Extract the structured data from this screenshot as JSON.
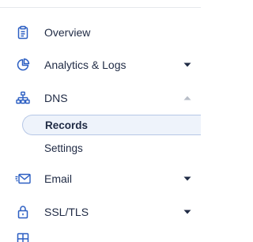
{
  "nav": {
    "items": [
      {
        "key": "overview",
        "label": "Overview",
        "icon": "clipboard-icon",
        "chevron": null
      },
      {
        "key": "analytics",
        "label": "Analytics & Logs",
        "icon": "pie-chart-icon",
        "chevron": "down"
      },
      {
        "key": "dns",
        "label": "DNS",
        "icon": "network-icon",
        "chevron": "up"
      },
      {
        "key": "email",
        "label": "Email",
        "icon": "email-icon",
        "chevron": "down"
      },
      {
        "key": "ssl",
        "label": "SSL/TLS",
        "icon": "lock-icon",
        "chevron": "down"
      }
    ],
    "dns_subitems": [
      {
        "key": "records",
        "label": "Records",
        "active": true
      },
      {
        "key": "settings",
        "label": "Settings",
        "active": false
      }
    ]
  },
  "colors": {
    "icon": "#2b5ec2",
    "text": "#1f2a44",
    "chevron": "#1f2a44",
    "chevron_collapsed": "#b8bec8",
    "active_bg": "#eef3fb",
    "active_border": "#b6c7e6",
    "divider": "#e6e8ec"
  }
}
